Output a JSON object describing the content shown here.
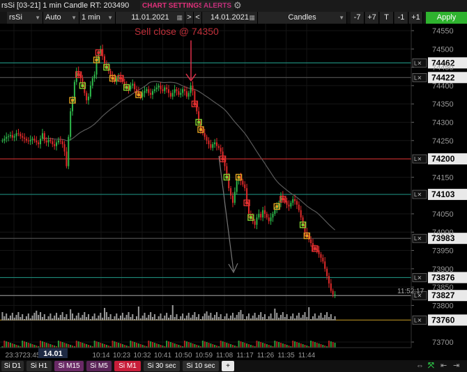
{
  "titlebar": {
    "title": "rsSi [03-21] 1 min Candle RT: 203490",
    "chart_settings": "CHART SETTINGS",
    "alerts": "ALERTS",
    "gear_icon": "gear-icon"
  },
  "toolbar": {
    "symbol": "rsSi",
    "scale": "Auto",
    "interval": "1 min",
    "date_from": "11.01.2021",
    "nav_prev": "<",
    "nav_next": ">",
    "date_to": "14.01.2021",
    "chart_type": "Candles",
    "btn_m7": "-7",
    "btn_p7": "+7",
    "btn_t": "T",
    "btn_m1": "-1",
    "btn_p1": "+1",
    "apply": "Apply"
  },
  "chart": {
    "annotation": "Sell close @ 74350",
    "time_marker": "11:52:17",
    "date_badge": "14.01",
    "colors": {
      "up": "#2db84a",
      "down": "#e02a2a",
      "bg": "#000000",
      "grid": "#1c1c1c"
    }
  },
  "chart_data": {
    "type": "candlestick",
    "y_ticks": [
      "74550",
      "74500",
      "74450",
      "74400",
      "74350",
      "74300",
      "74250",
      "74150",
      "74050",
      "74000",
      "73950",
      "73900",
      "73850",
      "73800",
      "73700"
    ],
    "x_ticks": [
      "23:37",
      "23:45",
      "10:14",
      "10:23",
      "10:32",
      "10:41",
      "10:50",
      "10:59",
      "11:08",
      "11:17",
      "11:26",
      "11:35",
      "11:44"
    ],
    "level_lines": [
      {
        "price": "74462",
        "color": "#1e8a7a"
      },
      {
        "price": "74422",
        "color": "#555555"
      },
      {
        "price": "74200",
        "color": "#d03030"
      },
      {
        "price": "74103",
        "color": "#1e8a7a"
      },
      {
        "price": "73983",
        "color": "#555555"
      },
      {
        "price": "73876",
        "color": "#1e8a7a"
      },
      {
        "price": "73827",
        "color": "#888888"
      },
      {
        "price": "73760",
        "color": "#b08a20"
      }
    ],
    "closes": [
      74250,
      74255,
      74260,
      74262,
      74265,
      74258,
      74262,
      74270,
      74268,
      74262,
      74258,
      74255,
      74250,
      74248,
      74252,
      74255,
      74250,
      74245,
      74240,
      74255,
      74270,
      74250,
      74245,
      74252,
      74248,
      74240,
      74235,
      74245,
      74250,
      74248,
      74240,
      74220,
      74180,
      74260,
      74330,
      74360,
      74410,
      74440,
      74430,
      74420,
      74400,
      74380,
      74360,
      74370,
      74400,
      74420,
      74430,
      74470,
      74490,
      74500,
      74480,
      74460,
      74450,
      74440,
      74430,
      74420,
      74410,
      74420,
      74425,
      74420,
      74410,
      74400,
      74395,
      74390,
      74400,
      74405,
      74390,
      74385,
      74375,
      74370,
      74380,
      74385,
      74390,
      74380,
      74375,
      74385,
      74390,
      74395,
      74400,
      74390,
      74385,
      74395,
      74390,
      74380,
      74370,
      74380,
      74390,
      74385,
      74375,
      74380,
      74390,
      74385,
      74370,
      74380,
      74400,
      74385,
      74350,
      74330,
      74300,
      74280,
      74270,
      74260,
      74250,
      74240,
      74230,
      74240,
      74245,
      74235,
      74230,
      74220,
      74200,
      74180,
      74150,
      74120,
      74100,
      74080,
      74110,
      74140,
      74150,
      74140,
      74130,
      74120,
      74080,
      74050,
      74040,
      74030,
      74020,
      74040,
      74050,
      74040,
      74060,
      74050,
      74040,
      74030,
      74040,
      74050,
      74060,
      74070,
      74080,
      74100,
      74090,
      74085,
      74075,
      74070,
      74080,
      74090,
      74085,
      74075,
      74060,
      74040,
      74020,
      74000,
      73990,
      73980,
      73970,
      73960,
      73955,
      73950,
      73940,
      73930,
      73920,
      73900,
      73880,
      73860,
      73840,
      73830,
      73830
    ]
  }
}
